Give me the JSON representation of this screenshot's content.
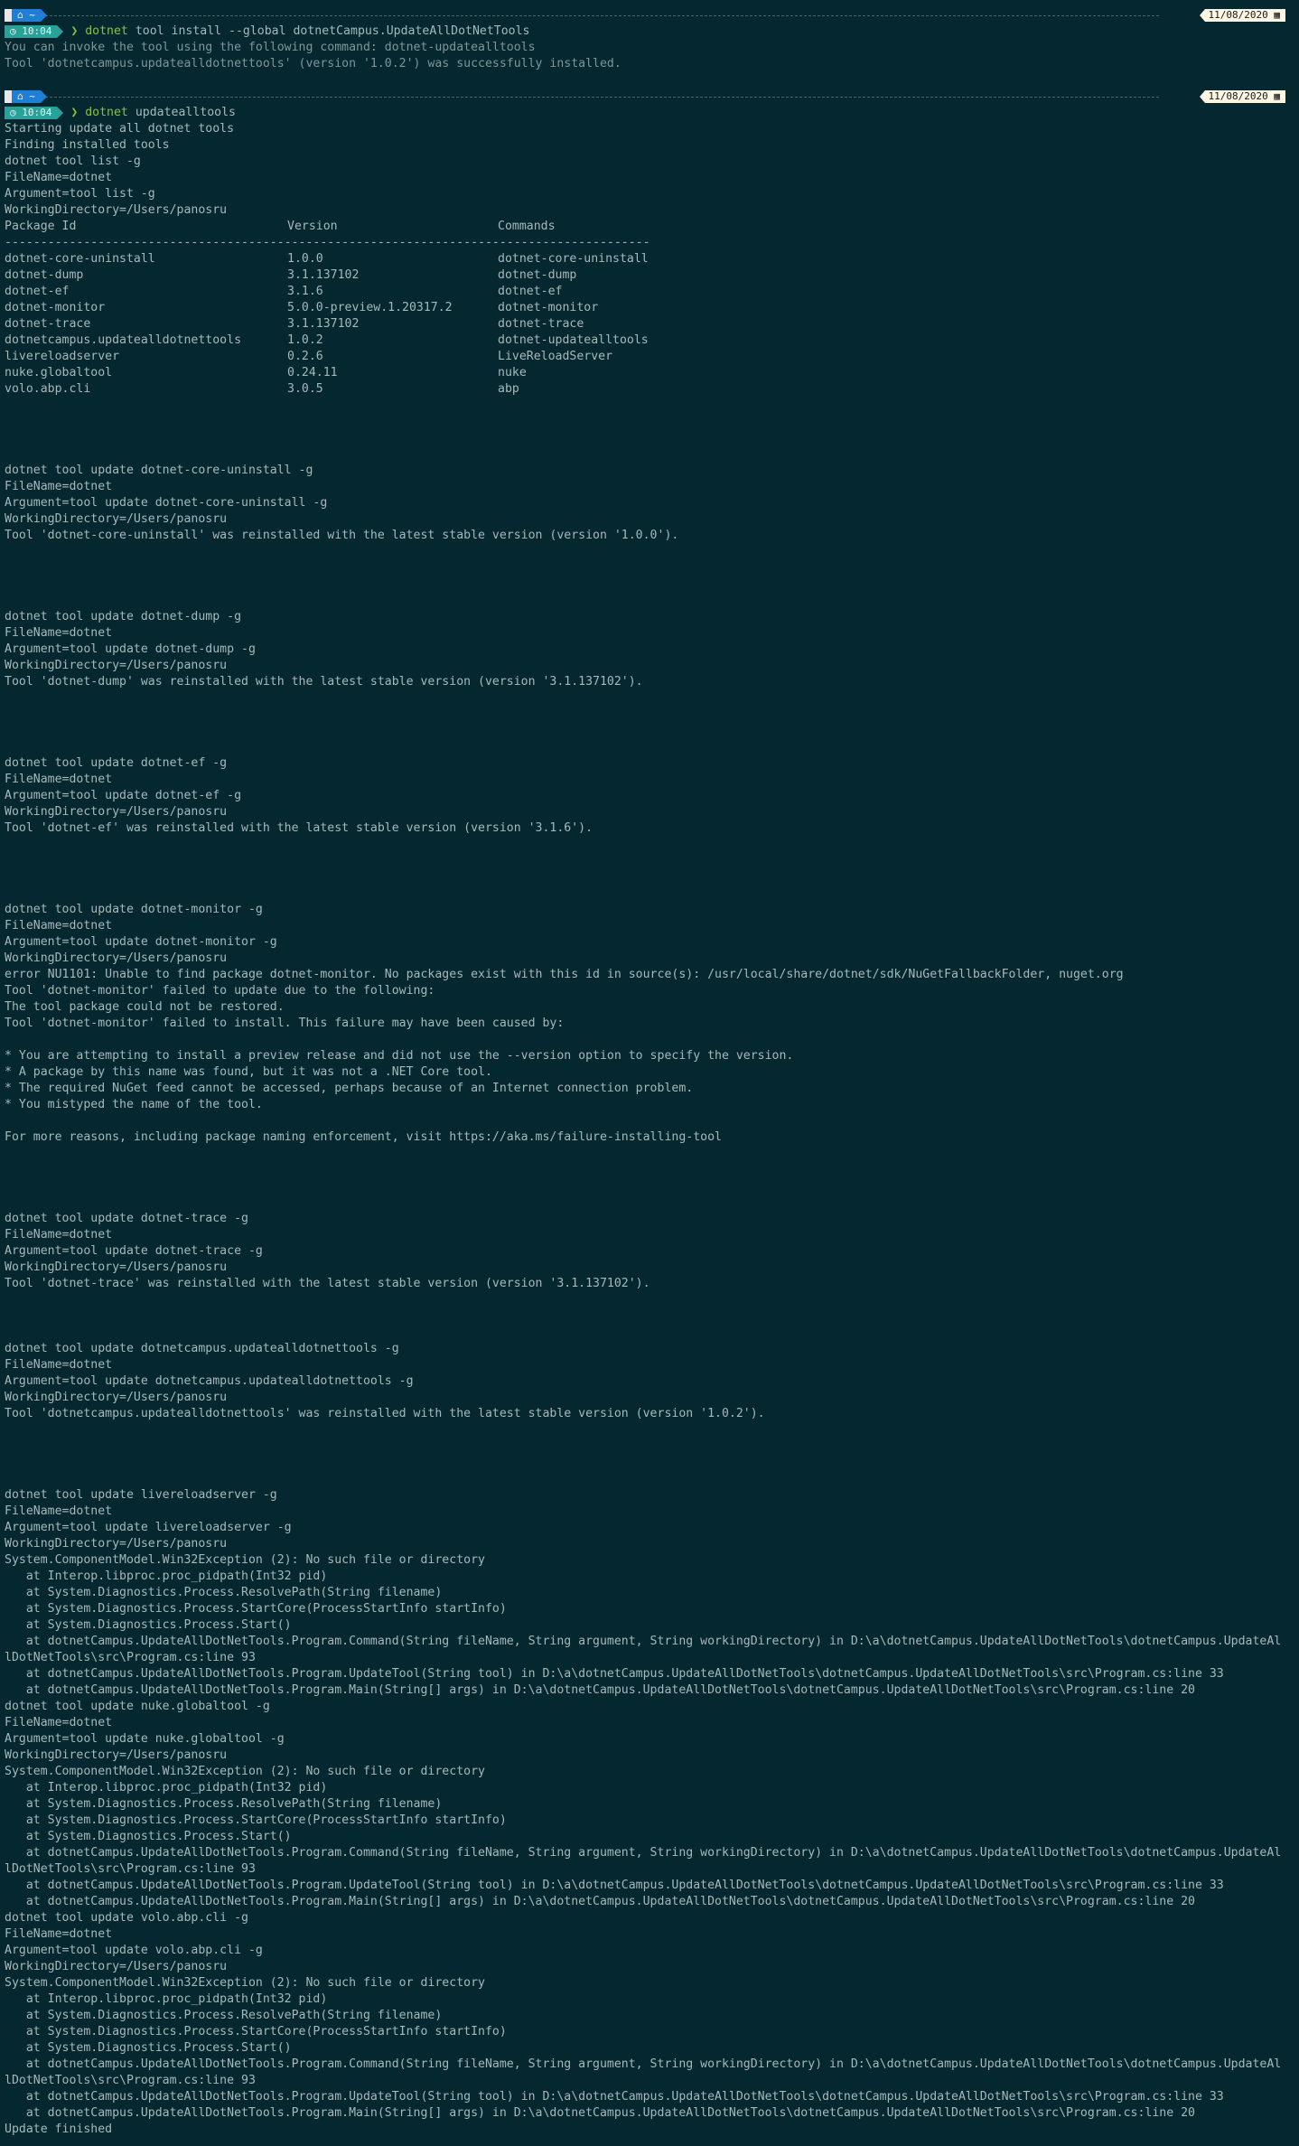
{
  "prompts": [
    {
      "apple_icon": "apple-icon",
      "dir": "~",
      "time": "10:04",
      "date": "11/08/2020",
      "command_head": "dotnet",
      "command_tail": " tool install --global dotnetCampus.UpdateAllDotNetTools"
    },
    {
      "apple_icon": "apple-icon",
      "dir": "~",
      "time": "10:04",
      "date": "11/08/2020",
      "command_head": "dotnet",
      "command_tail": " updatealltools"
    }
  ],
  "install_output": [
    "You can invoke the tool using the following command: dotnet-updatealltools",
    "Tool 'dotnetcampus.updatealldotnettools' (version '1.0.2') was successfully installed."
  ],
  "intro_lines": [
    "Starting update all dotnet tools",
    "Finding installed tools",
    "dotnet tool list -g",
    "FileName=dotnet",
    "Argument=tool list -g",
    "WorkingDirectory=/Users/panosru"
  ],
  "table": {
    "headers": [
      "Package Id",
      "Version",
      "Commands"
    ],
    "separator": "---------------------------------------------------------------------------------------------",
    "rows": [
      [
        "dotnet-core-uninstall",
        "1.0.0",
        "dotnet-core-uninstall"
      ],
      [
        "dotnet-dump",
        "3.1.137102",
        "dotnet-dump"
      ],
      [
        "dotnet-ef",
        "3.1.6",
        "dotnet-ef"
      ],
      [
        "dotnet-monitor",
        "5.0.0-preview.1.20317.2",
        "dotnet-monitor"
      ],
      [
        "dotnet-trace",
        "3.1.137102",
        "dotnet-trace"
      ],
      [
        "dotnetcampus.updatealldotnettools",
        "1.0.2",
        "dotnet-updatealltools"
      ],
      [
        "livereloadserver",
        "0.2.6",
        "LiveReloadServer"
      ],
      [
        "nuke.globaltool",
        "0.24.11",
        "nuke"
      ],
      [
        "volo.abp.cli",
        "3.0.5",
        "abp"
      ]
    ]
  },
  "log_lines": [
    "",
    "",
    "",
    "",
    "dotnet tool update dotnet-core-uninstall -g",
    "FileName=dotnet",
    "Argument=tool update dotnet-core-uninstall -g",
    "WorkingDirectory=/Users/panosru",
    "Tool 'dotnet-core-uninstall' was reinstalled with the latest stable version (version '1.0.0').",
    "",
    "",
    "",
    "",
    "dotnet tool update dotnet-dump -g",
    "FileName=dotnet",
    "Argument=tool update dotnet-dump -g",
    "WorkingDirectory=/Users/panosru",
    "Tool 'dotnet-dump' was reinstalled with the latest stable version (version '3.1.137102').",
    "",
    "",
    "",
    "",
    "dotnet tool update dotnet-ef -g",
    "FileName=dotnet",
    "Argument=tool update dotnet-ef -g",
    "WorkingDirectory=/Users/panosru",
    "Tool 'dotnet-ef' was reinstalled with the latest stable version (version '3.1.6').",
    "",
    "",
    "",
    "",
    "dotnet tool update dotnet-monitor -g",
    "FileName=dotnet",
    "Argument=tool update dotnet-monitor -g",
    "WorkingDirectory=/Users/panosru",
    "error NU1101: Unable to find package dotnet-monitor. No packages exist with this id in source(s): /usr/local/share/dotnet/sdk/NuGetFallbackFolder, nuget.org",
    "Tool 'dotnet-monitor' failed to update due to the following:",
    "The tool package could not be restored.",
    "Tool 'dotnet-monitor' failed to install. This failure may have been caused by:",
    "",
    "* You are attempting to install a preview release and did not use the --version option to specify the version.",
    "* A package by this name was found, but it was not a .NET Core tool.",
    "* The required NuGet feed cannot be accessed, perhaps because of an Internet connection problem.",
    "* You mistyped the name of the tool.",
    "",
    "For more reasons, including package naming enforcement, visit https://aka.ms/failure-installing-tool",
    "",
    "",
    "",
    "",
    "dotnet tool update dotnet-trace -g",
    "FileName=dotnet",
    "Argument=tool update dotnet-trace -g",
    "WorkingDirectory=/Users/panosru",
    "Tool 'dotnet-trace' was reinstalled with the latest stable version (version '3.1.137102').",
    "",
    "",
    "",
    "dotnet tool update dotnetcampus.updatealldotnettools -g",
    "FileName=dotnet",
    "Argument=tool update dotnetcampus.updatealldotnettools -g",
    "WorkingDirectory=/Users/panosru",
    "Tool 'dotnetcampus.updatealldotnettools' was reinstalled with the latest stable version (version '1.0.2').",
    "",
    "",
    "",
    "",
    "dotnet tool update livereloadserver -g",
    "FileName=dotnet",
    "Argument=tool update livereloadserver -g",
    "WorkingDirectory=/Users/panosru",
    "System.ComponentModel.Win32Exception (2): No such file or directory",
    "   at Interop.libproc.proc_pidpath(Int32 pid)",
    "   at System.Diagnostics.Process.ResolvePath(String filename)",
    "   at System.Diagnostics.Process.StartCore(ProcessStartInfo startInfo)",
    "   at System.Diagnostics.Process.Start()",
    "   at dotnetCampus.UpdateAllDotNetTools.Program.Command(String fileName, String argument, String workingDirectory) in D:\\a\\dotnetCampus.UpdateAllDotNetTools\\dotnetCampus.UpdateAl",
    "lDotNetTools\\src\\Program.cs:line 93",
    "   at dotnetCampus.UpdateAllDotNetTools.Program.UpdateTool(String tool) in D:\\a\\dotnetCampus.UpdateAllDotNetTools\\dotnetCampus.UpdateAllDotNetTools\\src\\Program.cs:line 33",
    "   at dotnetCampus.UpdateAllDotNetTools.Program.Main(String[] args) in D:\\a\\dotnetCampus.UpdateAllDotNetTools\\dotnetCampus.UpdateAllDotNetTools\\src\\Program.cs:line 20",
    "dotnet tool update nuke.globaltool -g",
    "FileName=dotnet",
    "Argument=tool update nuke.globaltool -g",
    "WorkingDirectory=/Users/panosru",
    "System.ComponentModel.Win32Exception (2): No such file or directory",
    "   at Interop.libproc.proc_pidpath(Int32 pid)",
    "   at System.Diagnostics.Process.ResolvePath(String filename)",
    "   at System.Diagnostics.Process.StartCore(ProcessStartInfo startInfo)",
    "   at System.Diagnostics.Process.Start()",
    "   at dotnetCampus.UpdateAllDotNetTools.Program.Command(String fileName, String argument, String workingDirectory) in D:\\a\\dotnetCampus.UpdateAllDotNetTools\\dotnetCampus.UpdateAl",
    "lDotNetTools\\src\\Program.cs:line 93",
    "   at dotnetCampus.UpdateAllDotNetTools.Program.UpdateTool(String tool) in D:\\a\\dotnetCampus.UpdateAllDotNetTools\\dotnetCampus.UpdateAllDotNetTools\\src\\Program.cs:line 33",
    "   at dotnetCampus.UpdateAllDotNetTools.Program.Main(String[] args) in D:\\a\\dotnetCampus.UpdateAllDotNetTools\\dotnetCampus.UpdateAllDotNetTools\\src\\Program.cs:line 20",
    "dotnet tool update volo.abp.cli -g",
    "FileName=dotnet",
    "Argument=tool update volo.abp.cli -g",
    "WorkingDirectory=/Users/panosru",
    "System.ComponentModel.Win32Exception (2): No such file or directory",
    "   at Interop.libproc.proc_pidpath(Int32 pid)",
    "   at System.Diagnostics.Process.ResolvePath(String filename)",
    "   at System.Diagnostics.Process.StartCore(ProcessStartInfo startInfo)",
    "   at System.Diagnostics.Process.Start()",
    "   at dotnetCampus.UpdateAllDotNetTools.Program.Command(String fileName, String argument, String workingDirectory) in D:\\a\\dotnetCampus.UpdateAllDotNetTools\\dotnetCampus.UpdateAl",
    "lDotNetTools\\src\\Program.cs:line 93",
    "   at dotnetCampus.UpdateAllDotNetTools.Program.UpdateTool(String tool) in D:\\a\\dotnetCampus.UpdateAllDotNetTools\\dotnetCampus.UpdateAllDotNetTools\\src\\Program.cs:line 33",
    "   at dotnetCampus.UpdateAllDotNetTools.Program.Main(String[] args) in D:\\a\\dotnetCampus.UpdateAllDotNetTools\\dotnetCampus.UpdateAllDotNetTools\\src\\Program.cs:line 20",
    "Update finished"
  ],
  "colors": {
    "background": "#052830",
    "text": "#a6b8ba",
    "command_green": "#85c33c",
    "dir_segment": "#1e7fd6",
    "time_segment": "#2aa198",
    "date_segment": "#fdf6e3"
  }
}
